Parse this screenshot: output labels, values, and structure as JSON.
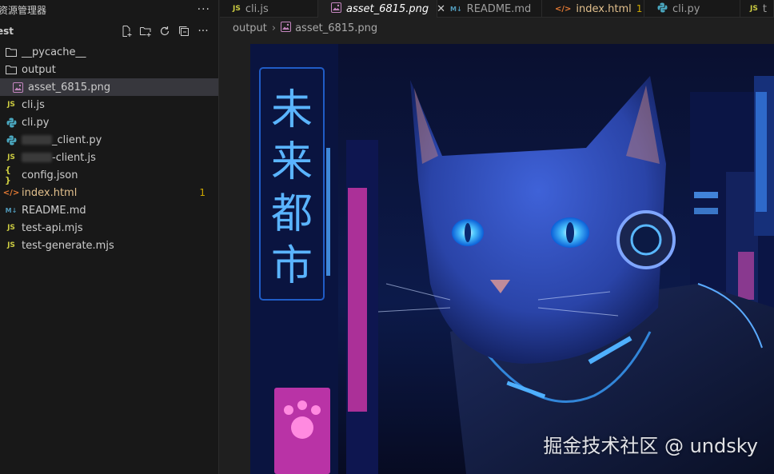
{
  "sidebar": {
    "title": "资源管理器",
    "more": "···",
    "section_label": "est",
    "items": [
      {
        "label": "__pycache__",
        "kind": "folder"
      },
      {
        "label": "output",
        "kind": "folder"
      },
      {
        "label": "asset_6815.png",
        "kind": "image"
      },
      {
        "label": "cli.js",
        "kind": "js",
        "icon_text": "JS"
      },
      {
        "label": "cli.py",
        "kind": "py"
      },
      {
        "label": "_client.py",
        "kind": "py"
      },
      {
        "label": "-client.js",
        "kind": "js",
        "icon_text": "JS"
      },
      {
        "label": "config.json",
        "kind": "json",
        "icon_text": "{ }"
      },
      {
        "label": "index.html",
        "kind": "html",
        "icon_text": "</>",
        "count": "1"
      },
      {
        "label": "README.md",
        "kind": "md",
        "icon_text": "M↓"
      },
      {
        "label": "test-api.mjs",
        "kind": "js",
        "icon_text": "JS"
      },
      {
        "label": "test-generate.mjs",
        "kind": "js",
        "icon_text": "JS"
      }
    ]
  },
  "tabs": [
    {
      "label": "cli.js",
      "icon_text": "JS"
    },
    {
      "label": "asset_6815.png",
      "active": true,
      "close": "✕"
    },
    {
      "label": "README.md",
      "icon_text": "M↓"
    },
    {
      "label": "index.html",
      "icon_text": "</>",
      "count": "1"
    },
    {
      "label": "cli.py"
    },
    {
      "label": "t",
      "icon_text": "JS"
    }
  ],
  "breadcrumb": {
    "folder": "output",
    "file": "asset_6815.png"
  },
  "image": {
    "sign_text": [
      "未",
      "来",
      "都",
      "市"
    ],
    "watermark": "掘金技术社区 @ undsky"
  },
  "colors": {
    "accent_yellow": "#cbcb41",
    "modified": "#e2c08d",
    "selection": "#37373d"
  }
}
